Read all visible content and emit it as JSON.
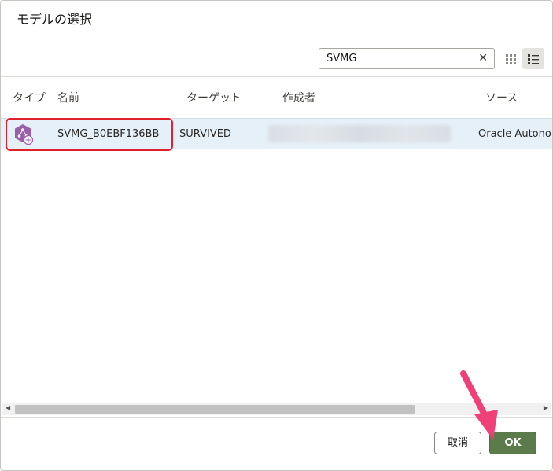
{
  "dialog": {
    "title": "モデルの選択"
  },
  "search": {
    "value": "SVMG",
    "clear_icon": "close-icon"
  },
  "view_toggle": {
    "grid_icon": "grid-view-icon",
    "list_icon": "list-view-icon",
    "selected": "list"
  },
  "table": {
    "columns": [
      "タイプ",
      "名前",
      "ターゲット",
      "作成者",
      "ソース"
    ],
    "rows": [
      {
        "type_icon": "model-icon",
        "name": "SVMG_B0EBF136BB",
        "target": "SURVIVED",
        "creator": "",
        "source": "Oracle Autono"
      }
    ]
  },
  "buttons": {
    "cancel": "取消",
    "ok": "OK"
  },
  "colors": {
    "ok_button": "#5b7b4a",
    "selected_row": "#e6f0f8",
    "highlight_border": "#e0202b",
    "annotation_arrow": "#f0407a",
    "type_icon": "#9b5ea8"
  }
}
